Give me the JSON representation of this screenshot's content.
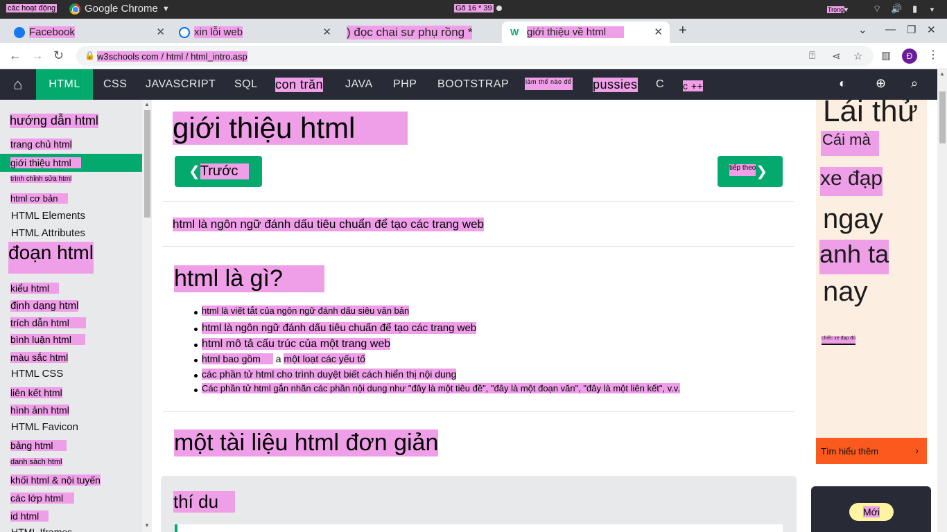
{
  "os": {
    "activities": "các hoạt động",
    "app_name": "Google Chrome",
    "clock": "Gõ 16 * 39",
    "input_lang": "Trong"
  },
  "tabs": [
    {
      "title": "Facebook",
      "favicon": "facebook-icon"
    },
    {
      "title": "xin lỗi web",
      "favicon": "zalo-icon"
    },
    {
      "title": ") đọc chai sư phụ rồng *",
      "favicon": ""
    },
    {
      "title": "giới thiệu về html",
      "favicon": "w3schools-icon"
    }
  ],
  "address": {
    "url": "w3schools com / html / html_intro.asp",
    "avatar_letter": "Đ"
  },
  "w3nav": {
    "items": [
      "HTML",
      "CSS",
      "JAVASCRIPT",
      "SQL",
      "con trăn",
      "JAVA",
      "PHP",
      "BOOTSTRAP",
      "làm thế nào để",
      "pussies",
      "C",
      "c ++"
    ]
  },
  "sidebar": {
    "heading": "hướng dẫn html",
    "items": [
      "trang chủ html",
      "giới thiệu html",
      "trình chỉnh sửa html",
      "html cơ bản",
      "HTML Elements",
      "HTML Attributes",
      "đoạn html",
      "kiểu html",
      "định dạng html",
      "trích dẫn html",
      "bình luận html",
      "màu sắc html",
      "HTML CSS",
      "liên kết html",
      "hình ảnh html",
      "HTML Favicon",
      "bảng html",
      "danh sách html",
      "khối html & nội tuyến",
      "các lớp html",
      "id html",
      "HTML Iframes"
    ]
  },
  "main": {
    "title": "giới thiệu html",
    "prev_label": "Trước",
    "next_label": "tiếp theo",
    "intro": "html là ngôn ngữ đánh dấu tiêu chuẩn để tạo các trang web",
    "what_heading": "html là gì?",
    "bullets": [
      "html là viết tắt của ngôn ngữ đánh dấu siêu văn bản",
      "html là ngôn ngữ đánh dấu tiêu chuẩn để tạo các trang web",
      "html mô tả cấu trúc của một trang web",
      "html bao gồm",
      "a",
      "một loạt các yếu tố",
      "các phần tử html cho trình duyệt biết cách hiển thị nội dung",
      "Các phần tử html gắn nhãn các phần nội dung như \"đây là một tiêu đề\", \"đây là một đoạn văn\", \"đây là một liên kết\", v.v."
    ],
    "doc_heading": "một tài liệu html đơn giản",
    "example_heading": "thí du"
  },
  "ad": {
    "lines": [
      "Lái thử",
      "Cái mà",
      "xe đạp",
      "ngay",
      "anh ta",
      "nay"
    ],
    "small": "chiếc xe đạp đó",
    "cta": "Tìm hiểu thêm",
    "new_badge": "Mới"
  }
}
